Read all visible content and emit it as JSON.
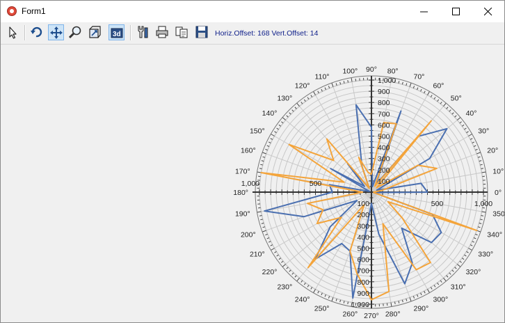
{
  "window": {
    "title": "Form1"
  },
  "toolbar": {
    "buttons": [
      {
        "icon": "pointer-icon",
        "name": "pointer-tool-button",
        "active": false
      },
      {
        "icon": "rotate-icon",
        "name": "rotate-tool-button",
        "active": false
      },
      {
        "icon": "move-icon",
        "name": "move-tool-button",
        "active": true
      },
      {
        "icon": "zoom-icon",
        "name": "zoom-tool-button",
        "active": false
      },
      {
        "icon": "depth-icon",
        "name": "depth-tool-button",
        "active": false
      },
      {
        "icon": "3d-icon",
        "name": "3d-toggle-button",
        "active": true,
        "text": "3d"
      },
      {
        "icon": "editor-icon",
        "name": "editor-button",
        "active": false
      },
      {
        "icon": "print-icon",
        "name": "print-button",
        "active": false
      },
      {
        "icon": "copy-icon",
        "name": "copy-button",
        "active": false
      },
      {
        "icon": "save-icon",
        "name": "save-button",
        "active": false
      }
    ],
    "offset_text": "Horiz.Offset: 168 Vert.Offset: 14"
  },
  "colors": {
    "series1": "#4a6fb0",
    "series2": "#f4a43a",
    "grid": "#c8c8c8",
    "axis": "#333333"
  },
  "chart_data": {
    "type": "polar",
    "radial_range": [
      0,
      1000
    ],
    "radial_ticks": [
      "100",
      "200",
      "300",
      "400",
      "500",
      "600",
      "700",
      "800",
      "900",
      "1,000"
    ],
    "axis_labels": {
      "left_500": "500",
      "left_1000": "1,000",
      "right_500": "500",
      "right_1000": "1,000"
    },
    "angle_labels": [
      "0°",
      "10°",
      "20°",
      "30°",
      "40°",
      "50°",
      "60°",
      "70°",
      "80°",
      "90°",
      "100°",
      "110°",
      "120°",
      "130°",
      "140°",
      "150°",
      "160°",
      "170°",
      "180°",
      "190°",
      "200°",
      "210°",
      "220°",
      "230°",
      "240°",
      "250°",
      "260°",
      "270°",
      "280°",
      "290°",
      "300°",
      "310°",
      "320°",
      "330°",
      "340°",
      "350°"
    ],
    "grid": true,
    "series": [
      {
        "color": "#4a6fb0",
        "points": [
          [
            0,
            500
          ],
          [
            10,
            450
          ],
          [
            20,
            50
          ],
          [
            30,
            600
          ],
          [
            40,
            880
          ],
          [
            50,
            650
          ],
          [
            60,
            80
          ],
          [
            70,
            770
          ],
          [
            80,
            50
          ],
          [
            90,
            580
          ],
          [
            100,
            790
          ],
          [
            110,
            250
          ],
          [
            120,
            40
          ],
          [
            130,
            330
          ],
          [
            140,
            80
          ],
          [
            150,
            420
          ],
          [
            160,
            20
          ],
          [
            170,
            380
          ],
          [
            180,
            350
          ],
          [
            190,
            970
          ],
          [
            200,
            640
          ],
          [
            210,
            150
          ],
          [
            220,
            480
          ],
          [
            230,
            780
          ],
          [
            240,
            530
          ],
          [
            250,
            560
          ],
          [
            260,
            960
          ],
          [
            270,
            100
          ],
          [
            280,
            380
          ],
          [
            290,
            870
          ],
          [
            300,
            730
          ],
          [
            310,
            420
          ],
          [
            320,
            700
          ],
          [
            330,
            720
          ],
          [
            340,
            580
          ],
          [
            350,
            20
          ]
        ]
      },
      {
        "color": "#f4a43a",
        "points": [
          [
            0,
            20
          ],
          [
            10,
            100
          ],
          [
            20,
            620
          ],
          [
            30,
            480
          ],
          [
            40,
            60
          ],
          [
            50,
            830
          ],
          [
            60,
            60
          ],
          [
            70,
            650
          ],
          [
            80,
            630
          ],
          [
            90,
            160
          ],
          [
            100,
            180
          ],
          [
            110,
            330
          ],
          [
            120,
            40
          ],
          [
            130,
            620
          ],
          [
            140,
            440
          ],
          [
            150,
            850
          ],
          [
            160,
            260
          ],
          [
            170,
            1000
          ],
          [
            180,
            80
          ],
          [
            190,
            580
          ],
          [
            200,
            460
          ],
          [
            210,
            560
          ],
          [
            220,
            350
          ],
          [
            230,
            880
          ],
          [
            240,
            130
          ],
          [
            250,
            560
          ],
          [
            260,
            740
          ],
          [
            270,
            960
          ],
          [
            280,
            900
          ],
          [
            290,
            300
          ],
          [
            300,
            800
          ],
          [
            310,
            820
          ],
          [
            320,
            360
          ],
          [
            330,
            170
          ],
          [
            340,
            1000
          ],
          [
            350,
            20
          ]
        ]
      }
    ]
  }
}
